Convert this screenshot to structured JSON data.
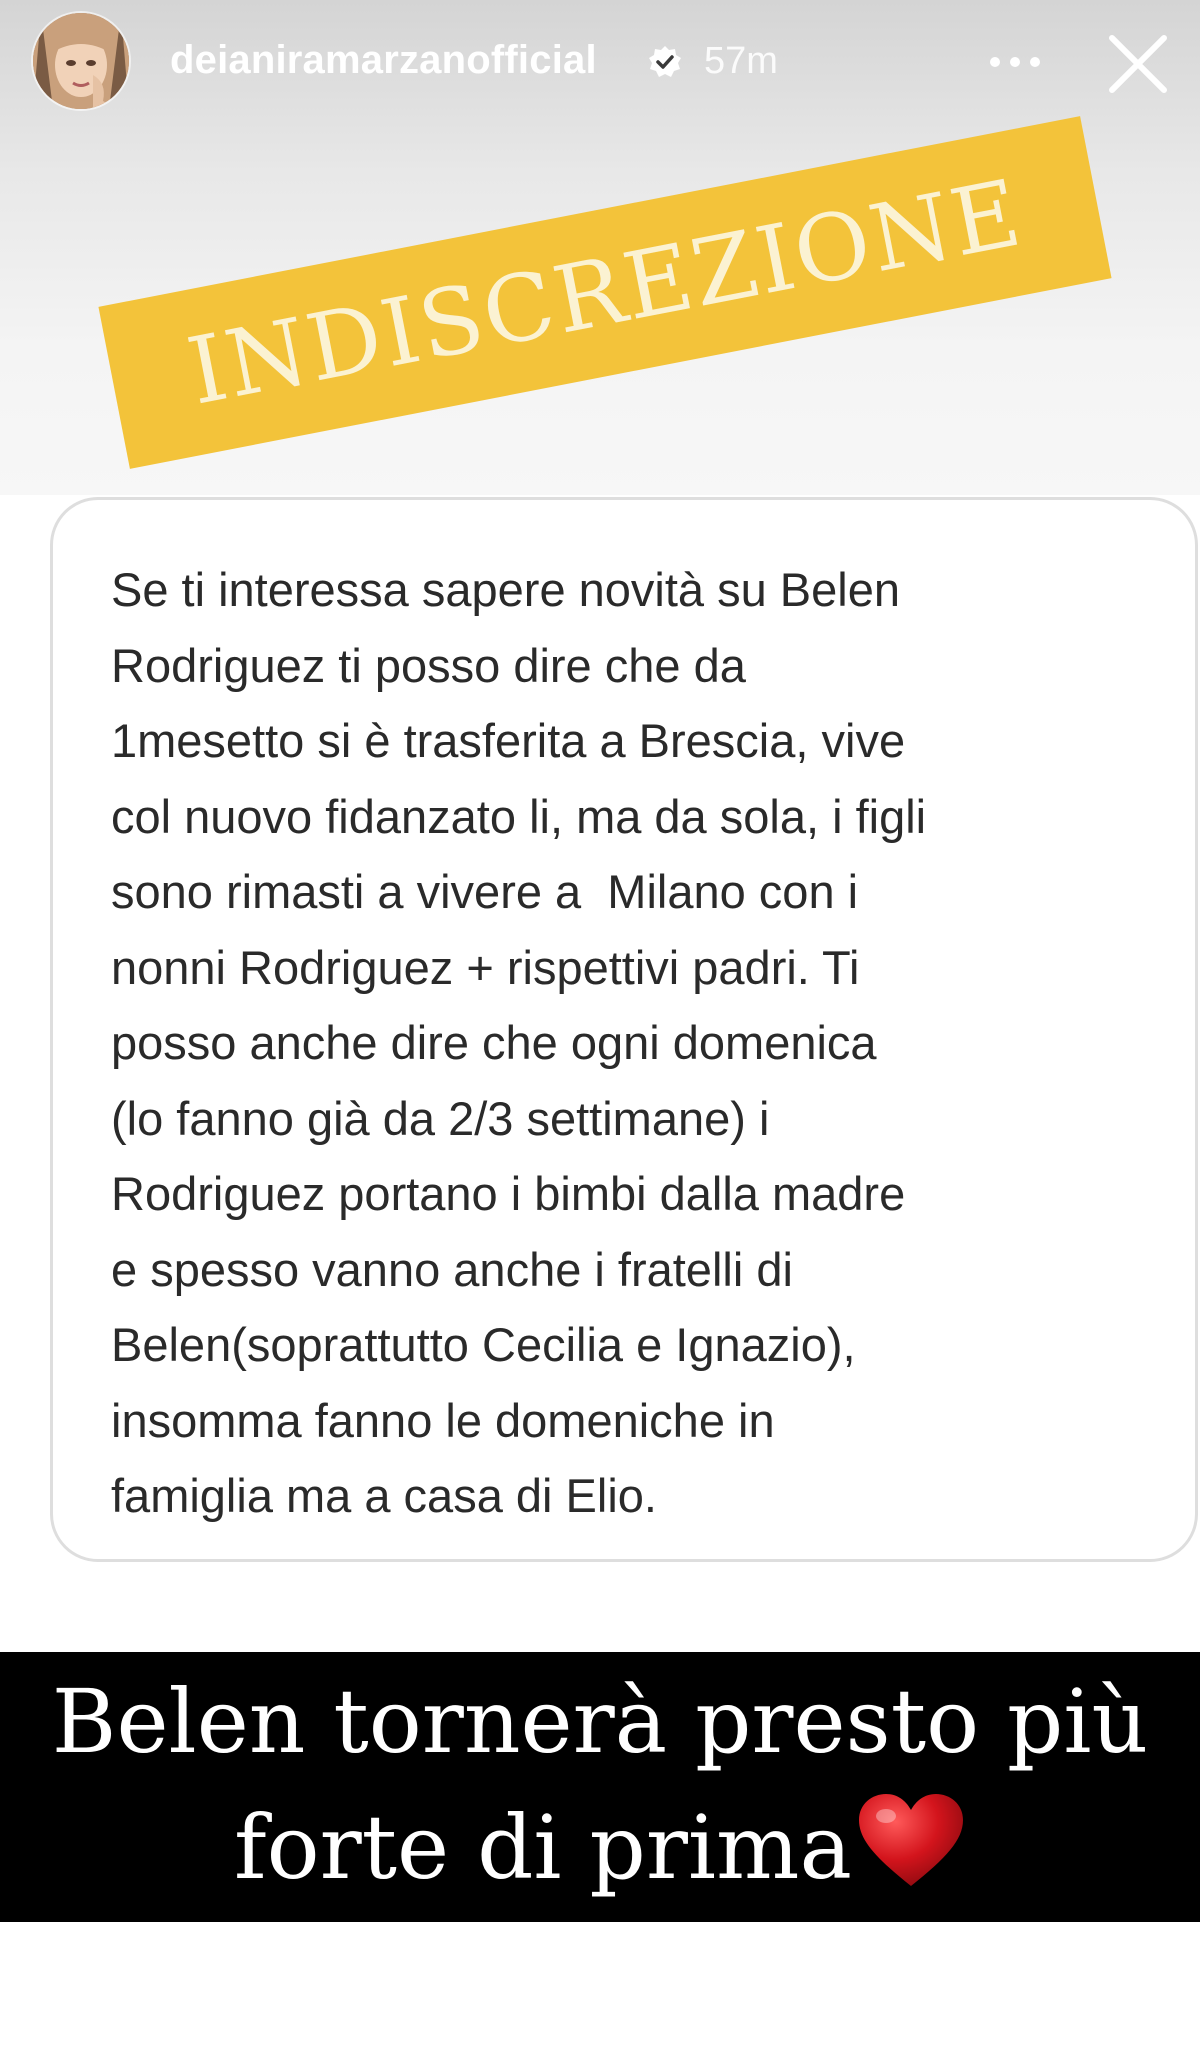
{
  "header": {
    "username": "deianiramarzanofficial",
    "timestamp": "57m",
    "icons": {
      "verified": "verified-badge-icon",
      "more": "more-options-icon",
      "close": "close-icon"
    }
  },
  "banner": {
    "text": "INDISCREZIONE",
    "color": "#f3c33a"
  },
  "message": {
    "lines": [
      "Se ti interessa sapere novità su Belen",
      "Rodriguez ti posso dire che da",
      "1mesetto si è trasferita a Brescia, vive",
      "col nuovo fidanzato li, ma da sola, i figli",
      "sono rimasti a vivere a  Milano con i",
      "nonni Rodriguez + rispettivi padri. Ti",
      "posso anche dire che ogni domenica",
      "(lo fanno già da 2/3 settimane) i",
      "Rodriguez portano i bimbi dalla madre",
      "e spesso vanno anche i fratelli di",
      "Belen(soprattutto Cecilia e Ignazio),",
      "insomma fanno le domeniche in",
      "famiglia ma a casa di Elio."
    ]
  },
  "caption": {
    "line1": "Belen tornerà presto più",
    "line2": "forte di prima",
    "emoji": "heart-icon"
  }
}
